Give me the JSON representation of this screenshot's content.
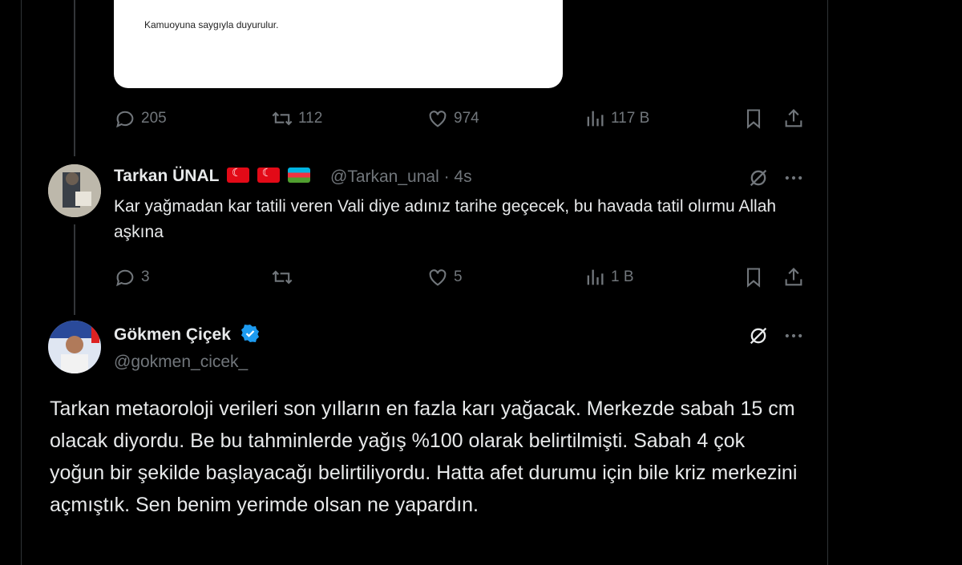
{
  "card": {
    "text": "Kamuoyuna saygıyla duyurulur."
  },
  "tweet1": {
    "replies": "205",
    "retweets": "112",
    "likes": "974",
    "views": "117 B"
  },
  "tweet2": {
    "name": "Tarkan ÜNAL",
    "handle": "@Tarkan_unal · 4s",
    "text": "Kar yağmadan kar tatili veren Vali diye adınız tarihe geçecek, bu havada tatil olırmu Allah aşkına",
    "replies": "3",
    "retweets": "",
    "likes": "5",
    "views": "1 B"
  },
  "tweet3": {
    "name": "Gökmen Çiçek",
    "handle": "@gokmen_cicek_",
    "text": "Tarkan metaoroloji verileri son yılların en fazla karı yağacak. Merkezde sabah 15 cm olacak diyordu. Be bu tahminlerde yağış %100 olarak belirtilmişti. Sabah 4 çok yoğun bir şekilde başlayacağı belirtiliyordu. Hatta afet durumu için bile kriz merkezini açmıştık. Sen benim yerimde olsan ne yapardın."
  },
  "colors": {
    "background": "#000000",
    "text": "#e7e9ea",
    "muted": "#71767b",
    "verified": "#1d9bf0"
  }
}
